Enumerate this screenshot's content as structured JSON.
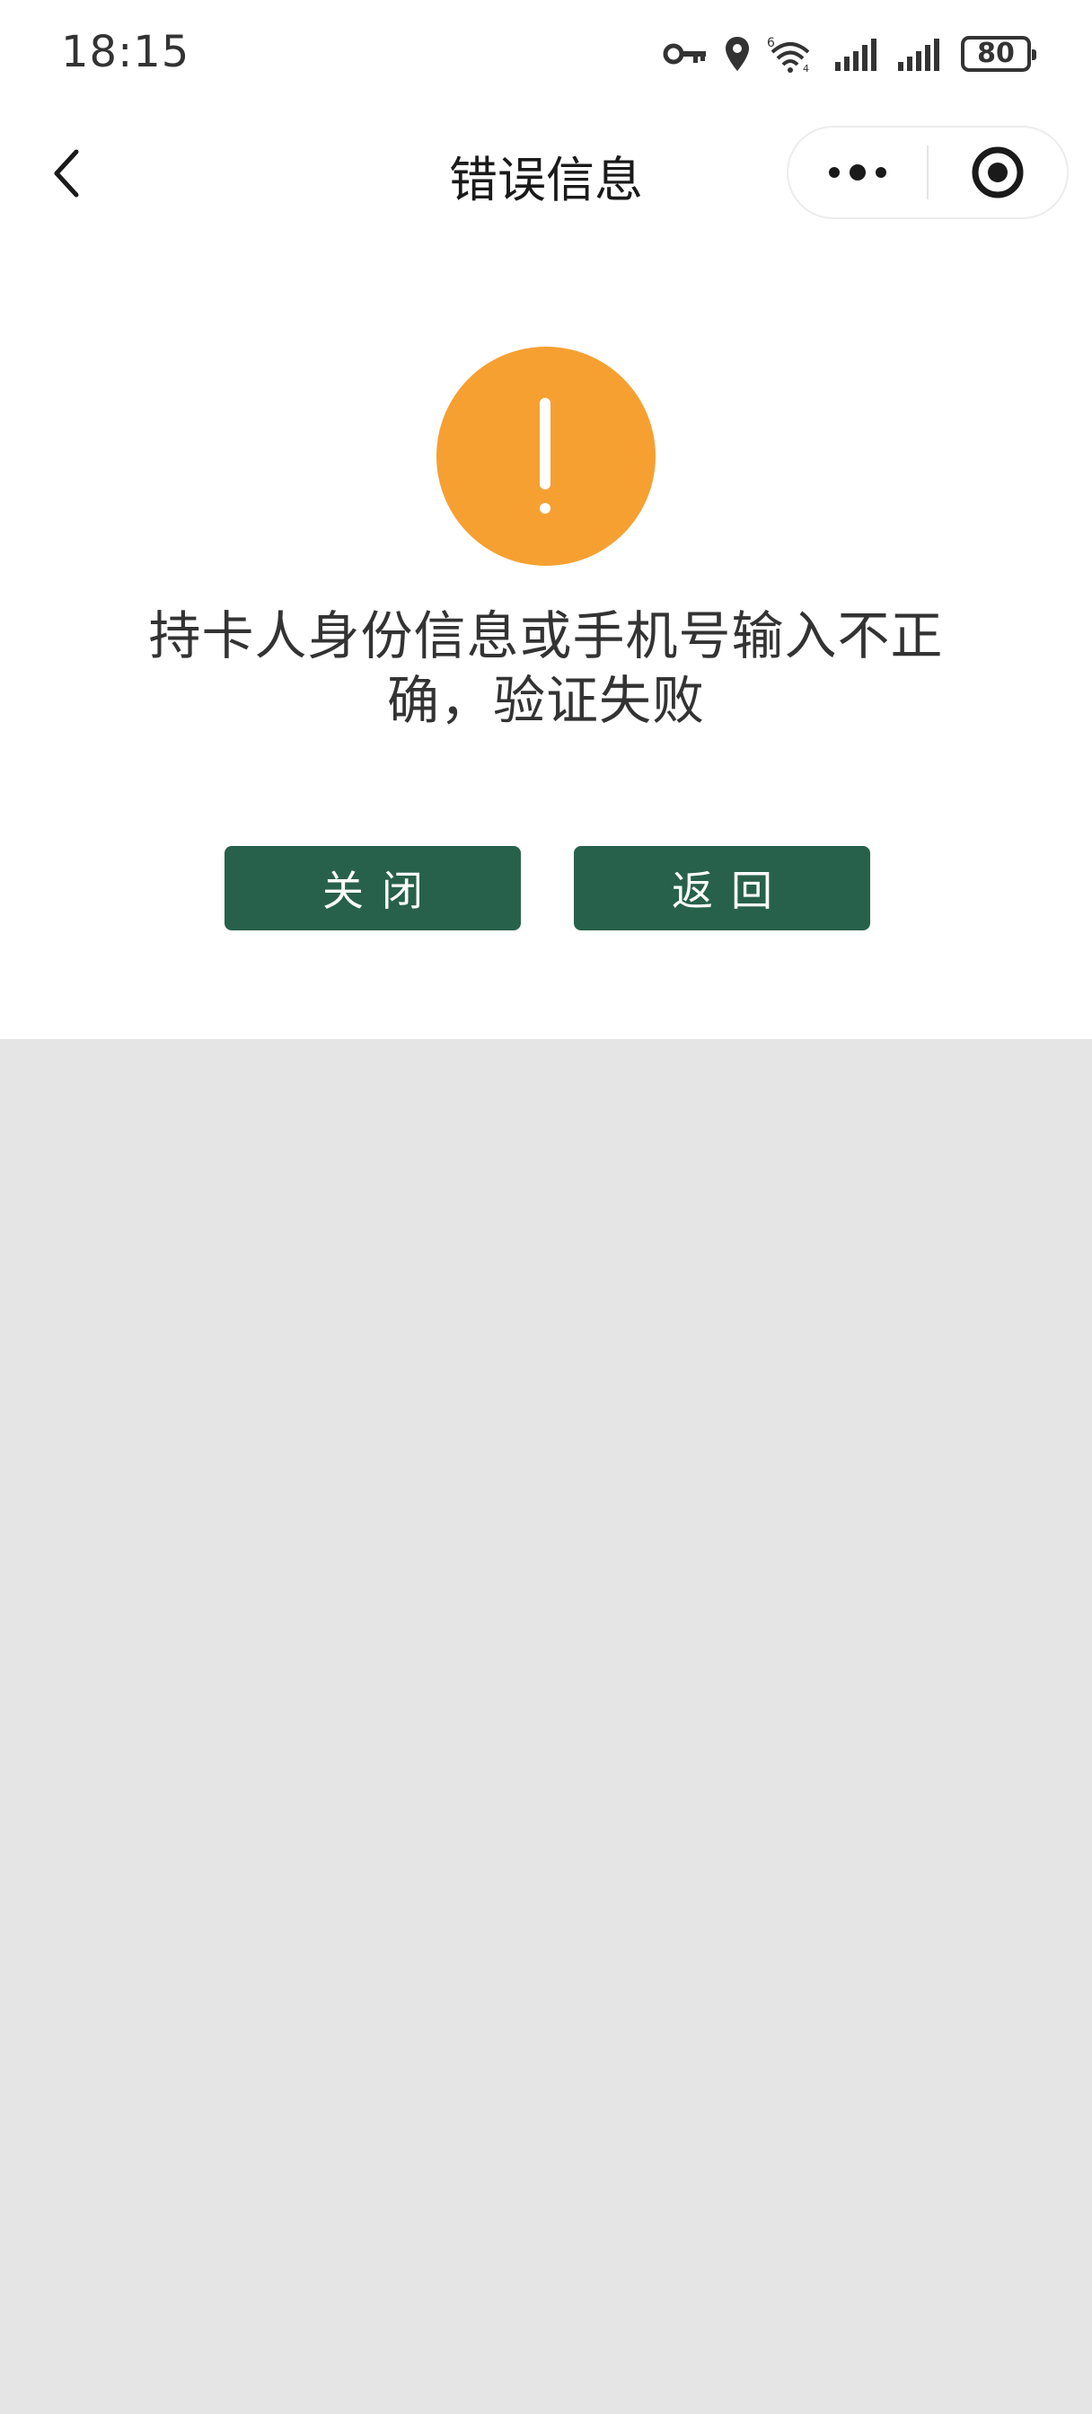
{
  "status_bar": {
    "time": "18:15",
    "battery_level": "80",
    "icons": [
      "vpn-key-icon",
      "location-icon",
      "wifi-icon",
      "signal-icon",
      "signal-icon",
      "battery-icon"
    ]
  },
  "nav": {
    "title": "错误信息",
    "back_icon": "chevron-left-icon",
    "more_icon": "more-dots-icon",
    "close_icon": "target-close-icon"
  },
  "content": {
    "icon": "warning-icon",
    "message": "持卡人身份信息或手机号输入不正确，验证失败"
  },
  "buttons": {
    "close_label": "关闭",
    "back_label": "返回"
  },
  "colors": {
    "warning": "#f6a032",
    "button": "#28614b",
    "background": "#e5e5e5"
  }
}
